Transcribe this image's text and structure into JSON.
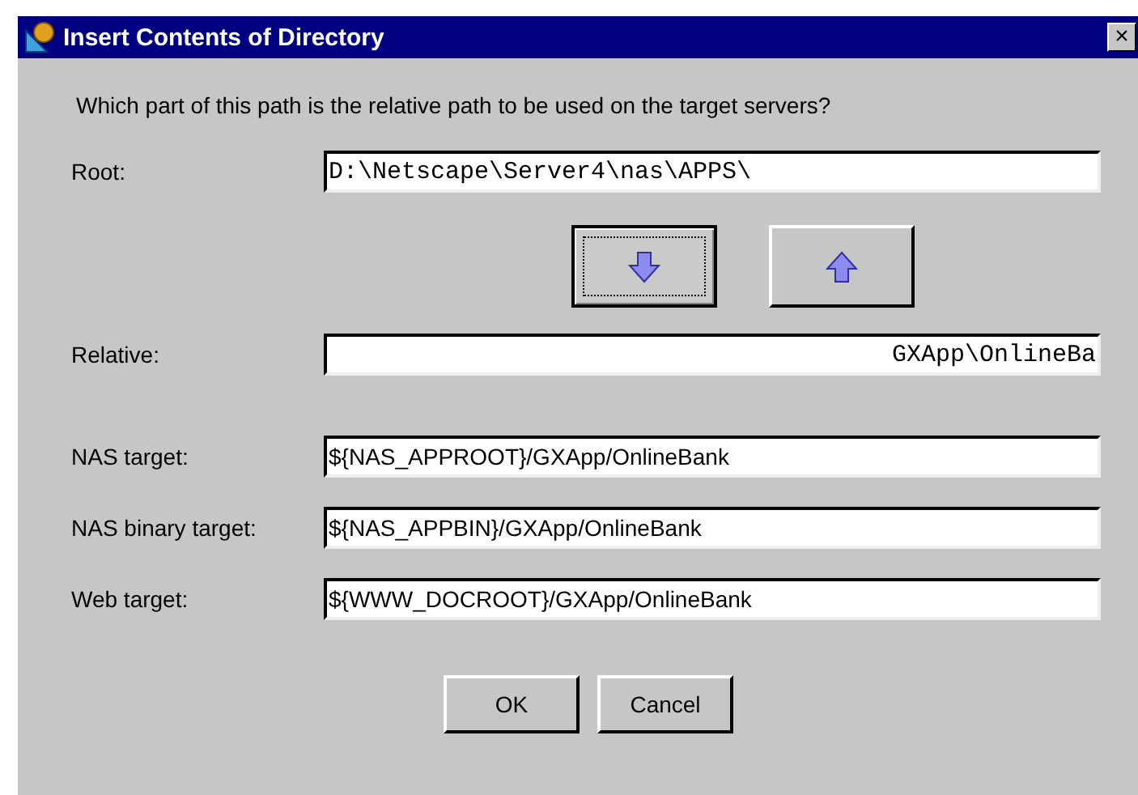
{
  "window": {
    "title": "Insert Contents of Directory",
    "close": "×"
  },
  "prompt": "Which part of this path is the relative path to be used on the target servers?",
  "root": {
    "label": "Root:",
    "value": "D:\\Netscape\\Server4\\nas\\APPS\\"
  },
  "move_buttons": [
    {
      "kind": "down",
      "focused": true
    },
    {
      "kind": "up",
      "focused": false
    }
  ],
  "relative": {
    "label": "Relative:",
    "value": "GXApp\\OnlineBa"
  },
  "targets": [
    {
      "label": "NAS target:",
      "value": "${NAS_APPROOT}/GXApp/OnlineBank"
    },
    {
      "label": "NAS binary target:",
      "value": "${NAS_APPBIN}/GXApp/OnlineBank"
    },
    {
      "label": "Web target:",
      "value": "${WWW_DOCROOT}/GXApp/OnlineBank"
    }
  ],
  "buttons": [
    "OK",
    "Cancel"
  ]
}
